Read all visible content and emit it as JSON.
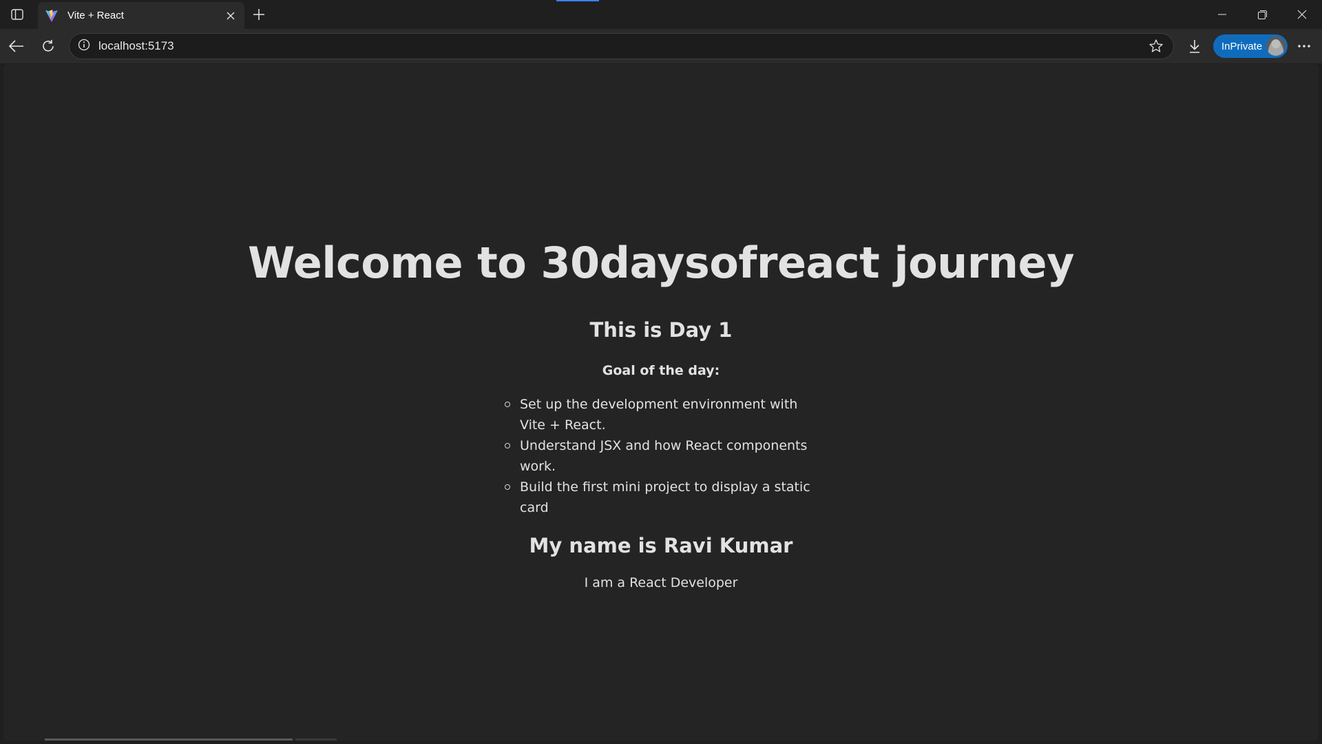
{
  "browser": {
    "tab": {
      "title": "Vite + React",
      "close_glyph": "✕"
    },
    "address": {
      "url": "localhost:5173"
    },
    "inprivate_label": "InPrivate",
    "colors": {
      "accent": "#0f6cbd",
      "tab_bg": "#2b2b2b",
      "page_bg": "#242424"
    }
  },
  "page": {
    "heading": "Welcome to 30daysofreact journey",
    "day": "This is Day 1",
    "goal_title": "Goal of the day:",
    "goals": [
      "Set up the development environment with Vite + React.",
      "Understand JSX and how React components work.",
      "Build the first mini project to display a static card"
    ],
    "name": "My name is Ravi Kumar",
    "role": "I am a React Developer"
  },
  "icons": [
    "sidebar-toggle-icon",
    "vite-logo-icon",
    "close-icon",
    "plus-icon",
    "minimize-icon",
    "restore-icon",
    "window-close-icon",
    "back-arrow-icon",
    "refresh-icon",
    "info-icon",
    "star-icon",
    "download-icon",
    "profile-avatar-icon",
    "more-icon"
  ]
}
